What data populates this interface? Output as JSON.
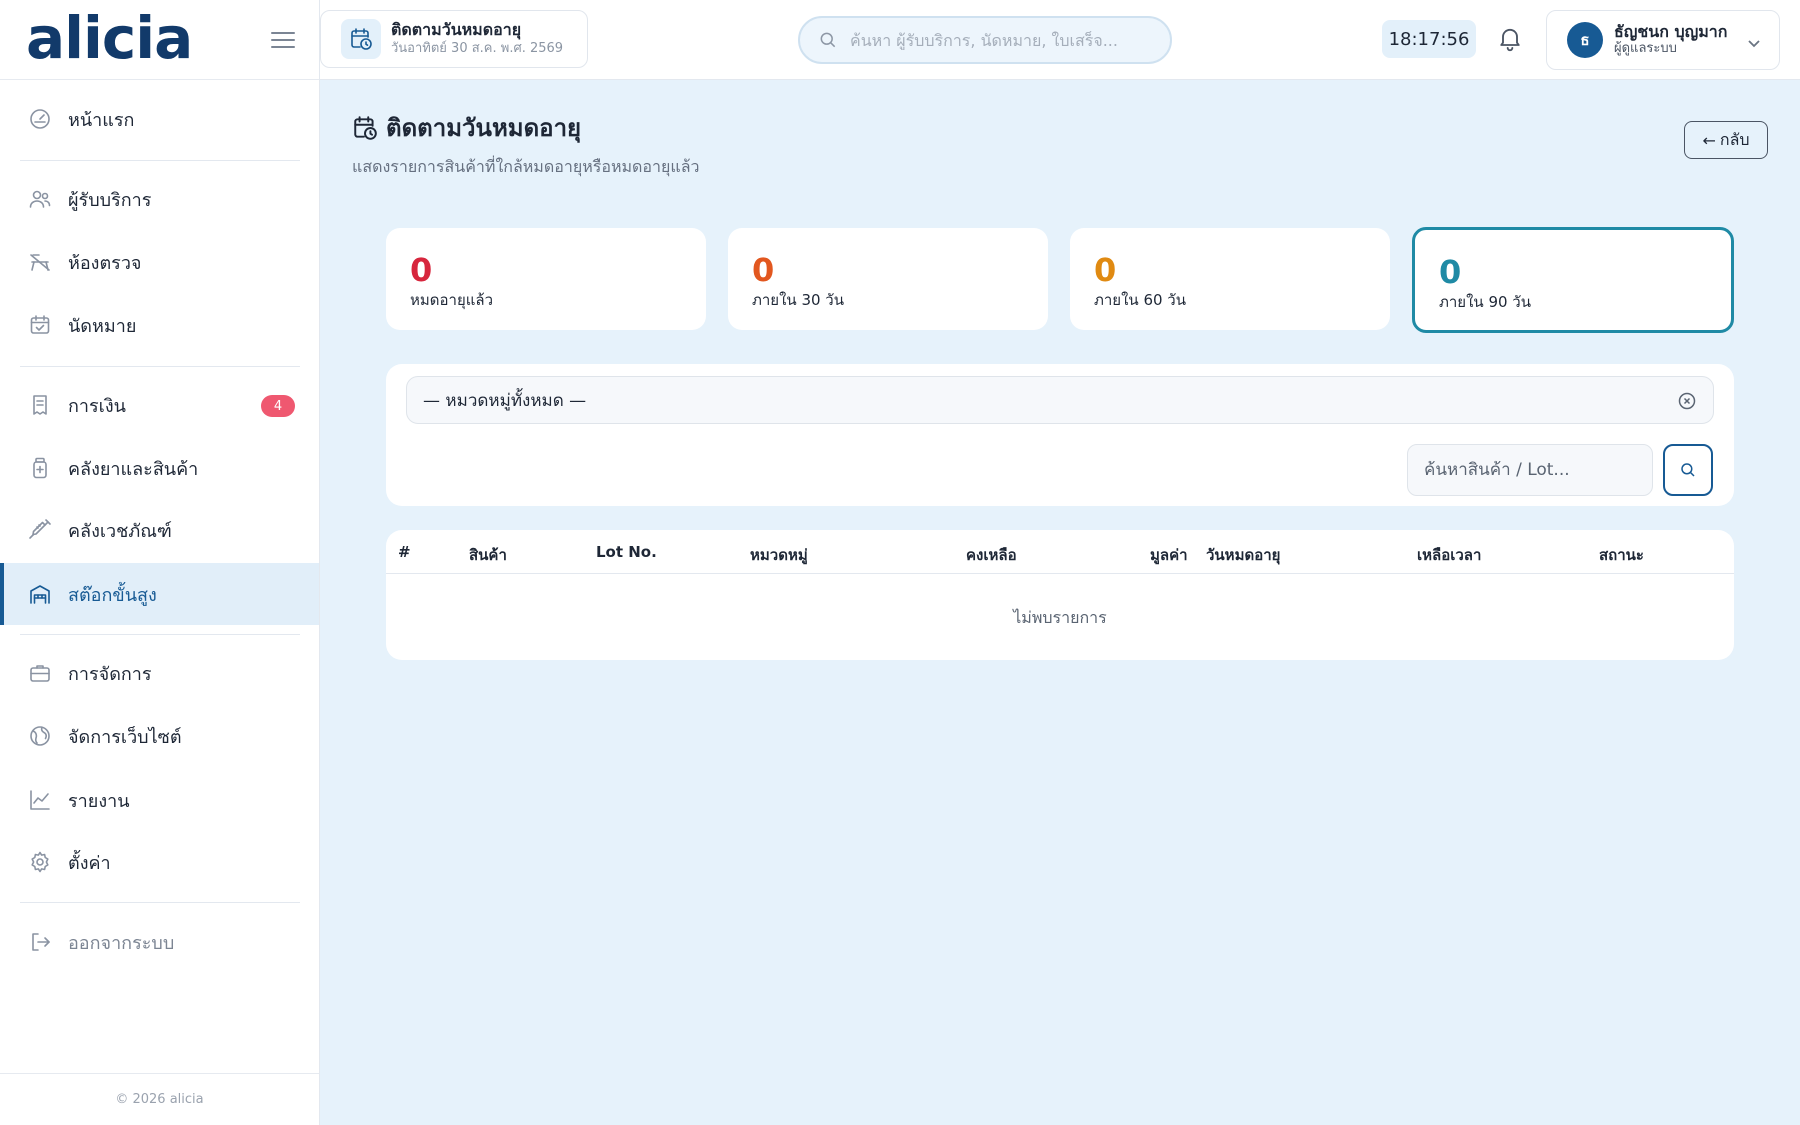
{
  "brand": {
    "name": "alicia"
  },
  "sidebar": {
    "items": [
      {
        "label": "หน้าแรก",
        "icon": "dashboard-gauge-icon"
      },
      {
        "label": "ผู้รับบริการ",
        "icon": "users-icon"
      },
      {
        "label": "ห้องตรวจ",
        "icon": "exam-room-icon"
      },
      {
        "label": "นัดหมาย",
        "icon": "calendar-check-icon"
      },
      {
        "label": "การเงิน",
        "icon": "receipt-icon",
        "badge": "4"
      },
      {
        "label": "คลังยาและสินค้า",
        "icon": "medicine-bottle-icon"
      },
      {
        "label": "คลังเวชภัณฑ์",
        "icon": "syringe-icon"
      },
      {
        "label": "สต๊อกขั้นสูง",
        "icon": "warehouse-icon",
        "active": true
      },
      {
        "label": "การจัดการ",
        "icon": "briefcase-icon"
      },
      {
        "label": "จัดการเว็บไซต์",
        "icon": "globe-icon"
      },
      {
        "label": "รายงาน",
        "icon": "chart-line-icon"
      },
      {
        "label": "ตั้งค่า",
        "icon": "gear-icon"
      },
      {
        "label": "ออกจากระบบ",
        "icon": "logout-icon"
      }
    ],
    "copyright": "© 2026 alicia"
  },
  "topbar": {
    "page_title": "ติดตามวันหมดอายุ",
    "page_date": "วันอาทิตย์ 30 ส.ค. พ.ศ. 2569",
    "search_placeholder": "ค้นหา ผู้รับบริการ, นัดหมาย, ใบเสร็จ...",
    "clock": "18:17:56",
    "user": {
      "initial": "ธ",
      "name": "ธัญชนก บุญมาก",
      "role": "ผู้ดูแลระบบ"
    }
  },
  "page": {
    "title": "ติดตามวันหมดอายุ",
    "subtitle": "แสดงรายการสินค้าที่ใกล้หมดอายุหรือหมดอายุแล้ว",
    "back_label": "กลับ"
  },
  "stats": [
    {
      "value": "0",
      "label": "หมดอายุแล้ว",
      "color": "#d7263d"
    },
    {
      "value": "0",
      "label": "ภายใน 30 วัน",
      "color": "#e2571f"
    },
    {
      "value": "0",
      "label": "ภายใน 60 วัน",
      "color": "#e08a12"
    },
    {
      "value": "0",
      "label": "ภายใน 90 วัน",
      "color": "#1f8aa5",
      "selected": true
    }
  ],
  "filter": {
    "category_value": "— หมวดหมู่ทั้งหมด —",
    "search_placeholder": "ค้นหาสินค้า / Lot..."
  },
  "table": {
    "columns": [
      "#",
      "สินค้า",
      "Lot No.",
      "หมวดหมู่",
      "คงเหลือ",
      "มูลค่า",
      "วันหมดอายุ",
      "เหลือเวลา",
      "สถานะ"
    ],
    "empty_text": "ไม่พบรายการ"
  },
  "colors": {
    "brand": "#123a6a",
    "accent": "#175a94",
    "background": "#e6f2fb",
    "badge": "#ef5870"
  }
}
